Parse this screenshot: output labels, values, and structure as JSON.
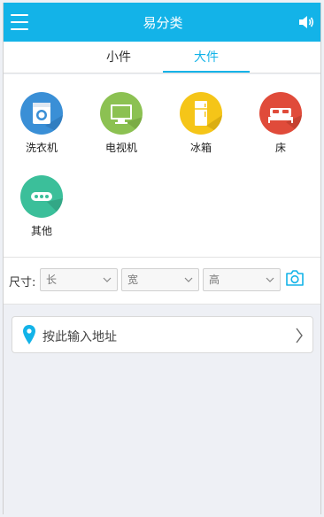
{
  "header": {
    "title": "易分类",
    "menu_icon": "menu-icon",
    "sound_icon": "speaker-icon"
  },
  "tabs": [
    {
      "label": "小件",
      "active": false
    },
    {
      "label": "大件",
      "active": true
    }
  ],
  "categories": [
    {
      "label": "洗衣机",
      "icon": "washing-machine-icon",
      "color": "#3a8fd6"
    },
    {
      "label": "电视机",
      "icon": "tv-icon",
      "color": "#8cc152"
    },
    {
      "label": "冰箱",
      "icon": "fridge-icon",
      "color": "#f5c518"
    },
    {
      "label": "床",
      "icon": "bed-icon",
      "color": "#e04b3a"
    },
    {
      "label": "其他",
      "icon": "more-icon",
      "color": "#3bbf9a"
    }
  ],
  "size": {
    "label": "尺寸:",
    "length": "长",
    "width": "宽",
    "height": "高",
    "camera_icon": "camera-icon"
  },
  "address": {
    "placeholder": "按此输入地址",
    "pin_icon": "location-pin-icon",
    "arrow_icon": "chevron-right-icon"
  },
  "colors": {
    "accent": "#13b3e8",
    "background": "#eef0f5"
  }
}
